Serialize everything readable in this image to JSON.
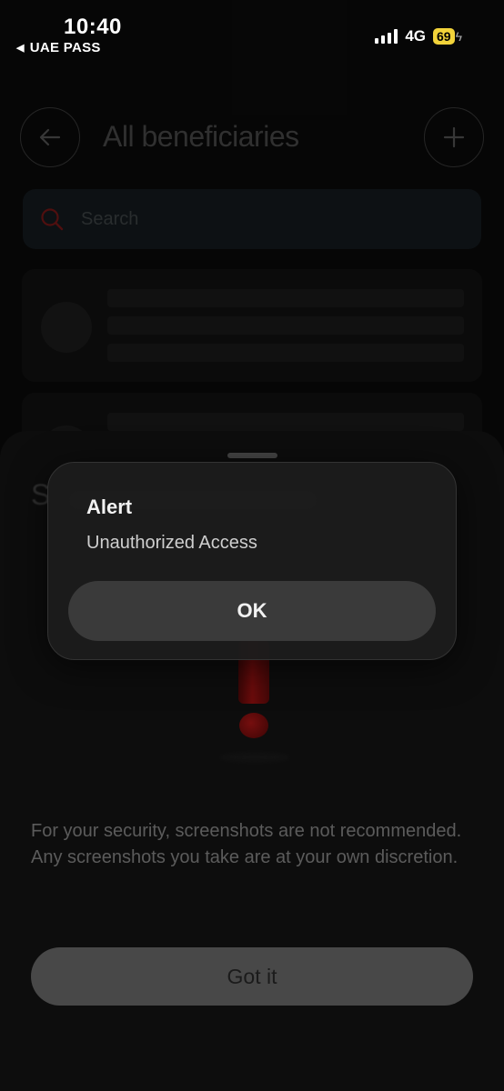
{
  "status_bar": {
    "time": "10:40",
    "back_app": "UAE PASS",
    "network": "4G",
    "battery": "69"
  },
  "header": {
    "title": "All beneficiaries",
    "back_icon": "arrow-left-icon",
    "add_icon": "plus-icon"
  },
  "search": {
    "placeholder": "Search",
    "icon": "search-icon",
    "icon_color": "#8a1a1a"
  },
  "sheet": {
    "title_initial": "S",
    "disclaimer": "For your security, screenshots are not recommended. Any screenshots you take are at your own discretion.",
    "got_it_label": "Got it",
    "illustration_icon": "exclamation-icon"
  },
  "alert": {
    "title": "Alert",
    "message": "Unauthorized Access",
    "ok_label": "OK"
  }
}
